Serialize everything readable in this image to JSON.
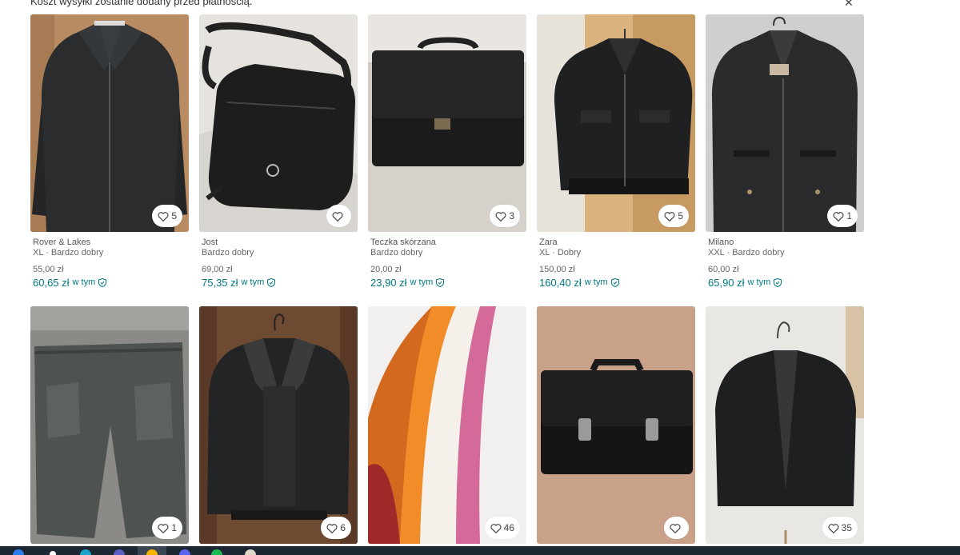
{
  "banner": {
    "text": "Koszt wysyłki zostanie dodany przed płatnością.",
    "close": "✕"
  },
  "items": [
    {
      "brand": "Rover & Lakes",
      "subtitle": "XL · Bardzo dobry",
      "price": "55,00 zł",
      "total": "60,65 zł",
      "incl": "w tym",
      "favorites": "5"
    },
    {
      "brand": "Jost",
      "subtitle": "Bardzo dobry",
      "price": "69,00 zł",
      "total": "75,35 zł",
      "incl": "w tym",
      "favorites": ""
    },
    {
      "brand": "Teczka skórzana",
      "subtitle": "Bardzo dobry",
      "price": "20,00 zł",
      "total": "23,90 zł",
      "incl": "w tym",
      "favorites": "3"
    },
    {
      "brand": "Zara",
      "subtitle": "XL · Dobry",
      "price": "150,00 zł",
      "total": "160,40 zł",
      "incl": "w tym",
      "favorites": "5"
    },
    {
      "brand": "Milano",
      "subtitle": "XXL · Bardzo dobry",
      "price": "60,00 zł",
      "total": "65,90 zł",
      "incl": "w tym",
      "favorites": "1"
    },
    {
      "favorites": "1"
    },
    {
      "favorites": "6"
    },
    {
      "favorites": "46"
    },
    {
      "favorites": ""
    },
    {
      "favorites": "35"
    }
  ],
  "colors": {
    "accent": "#007782",
    "taskbar": "#1d2733"
  },
  "icons": {
    "favorite": "heart-icon",
    "buyer_protection": "shield-check-icon",
    "close": "close-icon"
  }
}
